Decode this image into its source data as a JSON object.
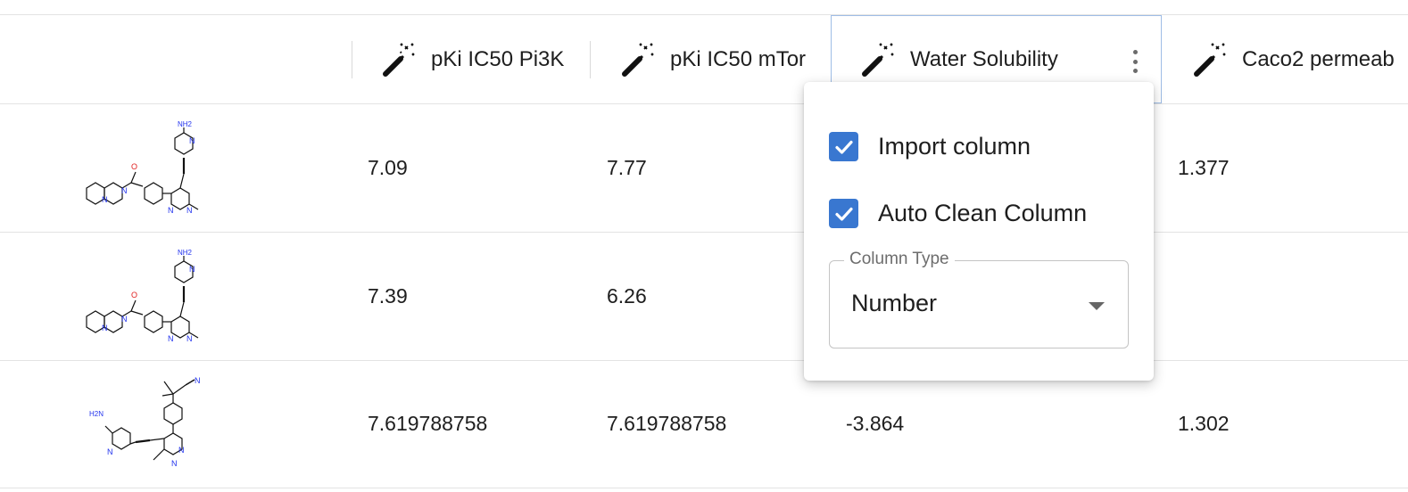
{
  "columns": [
    {
      "label": "pKi IC50 Pi3K",
      "icon": "magic-wand-icon"
    },
    {
      "label": "pKi IC50 mTor",
      "icon": "magic-wand-icon"
    },
    {
      "label": "Water Solubility",
      "icon": "magic-wand-icon",
      "active": true
    },
    {
      "label": "Caco2 permeab",
      "icon": "magic-wand-icon"
    }
  ],
  "rows": [
    {
      "pi3k": "7.09",
      "mtor": "7.77",
      "water": "",
      "caco2": "1.377",
      "structure_labels": {
        "amine": "NH2",
        "o": "O",
        "n": "N"
      }
    },
    {
      "pi3k": "7.39",
      "mtor": "6.26",
      "water": "",
      "caco2": "",
      "structure_labels": {
        "amine": "NH2",
        "o": "O",
        "n": "N"
      }
    },
    {
      "pi3k": "7.619788758",
      "mtor": "7.619788758",
      "water": "-3.864",
      "caco2": "1.302",
      "structure_labels": {
        "amine": "H2N",
        "n": "N"
      }
    }
  ],
  "column_menu": {
    "import_column": {
      "label": "Import column",
      "checked": true
    },
    "auto_clean": {
      "label": "Auto Clean Column",
      "checked": true
    },
    "column_type": {
      "legend": "Column Type",
      "value": "Number"
    }
  },
  "colors": {
    "accent": "#3977d0",
    "active_border": "#9fbde6",
    "nitrogen": "#2233ee",
    "oxygen": "#e02020"
  }
}
